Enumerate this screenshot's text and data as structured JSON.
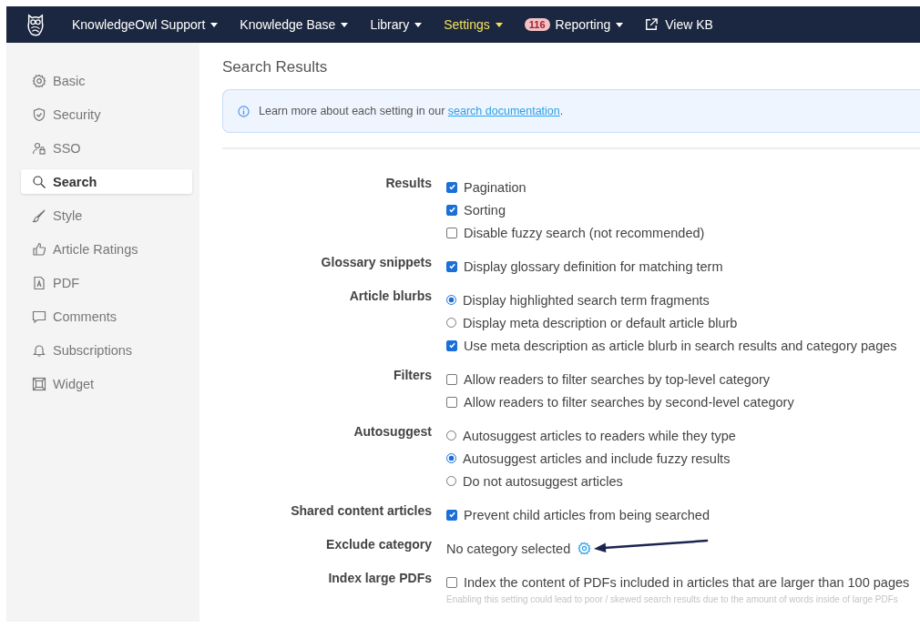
{
  "nav": [
    {
      "kind": "menu",
      "label": "KnowledgeOwl Support",
      "selected": false
    },
    {
      "kind": "menu",
      "label": "Knowledge Base",
      "selected": false
    },
    {
      "kind": "menu",
      "label": "Library",
      "selected": false
    },
    {
      "kind": "menu",
      "label": "Settings",
      "selected": true
    },
    {
      "kind": "menu",
      "label": "Reporting",
      "selected": false,
      "badge": "116"
    },
    {
      "kind": "link",
      "label": "View KB",
      "selected": false
    }
  ],
  "sidebar": {
    "items": [
      {
        "label": "Basic",
        "selected": false
      },
      {
        "label": "Security",
        "selected": false
      },
      {
        "label": "SSO",
        "selected": false
      },
      {
        "label": "Search",
        "selected": true
      },
      {
        "label": "Style",
        "selected": false
      },
      {
        "label": "Article Ratings",
        "selected": false
      },
      {
        "label": "PDF",
        "selected": false
      },
      {
        "label": "Comments",
        "selected": false
      },
      {
        "label": "Subscriptions",
        "selected": false
      },
      {
        "label": "Widget",
        "selected": false
      }
    ]
  },
  "page": {
    "title": "Search Results",
    "info": {
      "text": "Learn more about each setting in our ",
      "link": "search documentation",
      "after": "."
    }
  },
  "settings": [
    {
      "label": "Results",
      "options": [
        {
          "kind": "checkbox",
          "label": "Pagination",
          "checked": true
        },
        {
          "kind": "checkbox",
          "label": "Sorting",
          "checked": true
        },
        {
          "kind": "checkbox",
          "label": "Disable fuzzy search (not recommended)",
          "checked": false
        }
      ]
    },
    {
      "label": "Glossary snippets",
      "options": [
        {
          "kind": "checkbox",
          "label": "Display glossary definition for matching term",
          "checked": true
        }
      ]
    },
    {
      "label": "Article blurbs",
      "options": [
        {
          "kind": "radio",
          "label": "Display highlighted search term fragments",
          "checked": true
        },
        {
          "kind": "radio",
          "label": "Display meta description or default article blurb",
          "checked": false
        },
        {
          "kind": "checkbox",
          "label": "Use meta description as article blurb in search results and category pages",
          "checked": true
        }
      ]
    },
    {
      "label": "Filters",
      "options": [
        {
          "kind": "checkbox",
          "label": "Allow readers to filter searches by top-level category",
          "checked": false
        },
        {
          "kind": "checkbox",
          "label": "Allow readers to filter searches by second-level category",
          "checked": false
        }
      ]
    },
    {
      "label": "Autosuggest",
      "options": [
        {
          "kind": "radio",
          "label": "Autosuggest articles to readers while they type",
          "checked": false
        },
        {
          "kind": "radio",
          "label": "Autosuggest articles and include fuzzy results",
          "checked": true
        },
        {
          "kind": "radio",
          "label": "Do not autosuggest articles",
          "checked": false
        }
      ]
    },
    {
      "label": "Shared content articles",
      "options": [
        {
          "kind": "checkbox",
          "label": "Prevent child articles from being searched",
          "checked": true
        }
      ]
    },
    {
      "label": "Exclude category",
      "options": [
        {
          "kind": "value",
          "label": "No category selected",
          "annotated": true
        }
      ]
    },
    {
      "label": "Index large PDFs",
      "options": [
        {
          "kind": "checkbox",
          "label": "Index the content of PDFs included in articles that are larger than 100 pages",
          "checked": false
        }
      ],
      "hint": "Enabling this setting could lead to poor / skewed search results due to the amount of words inside of large PDFs"
    }
  ]
}
